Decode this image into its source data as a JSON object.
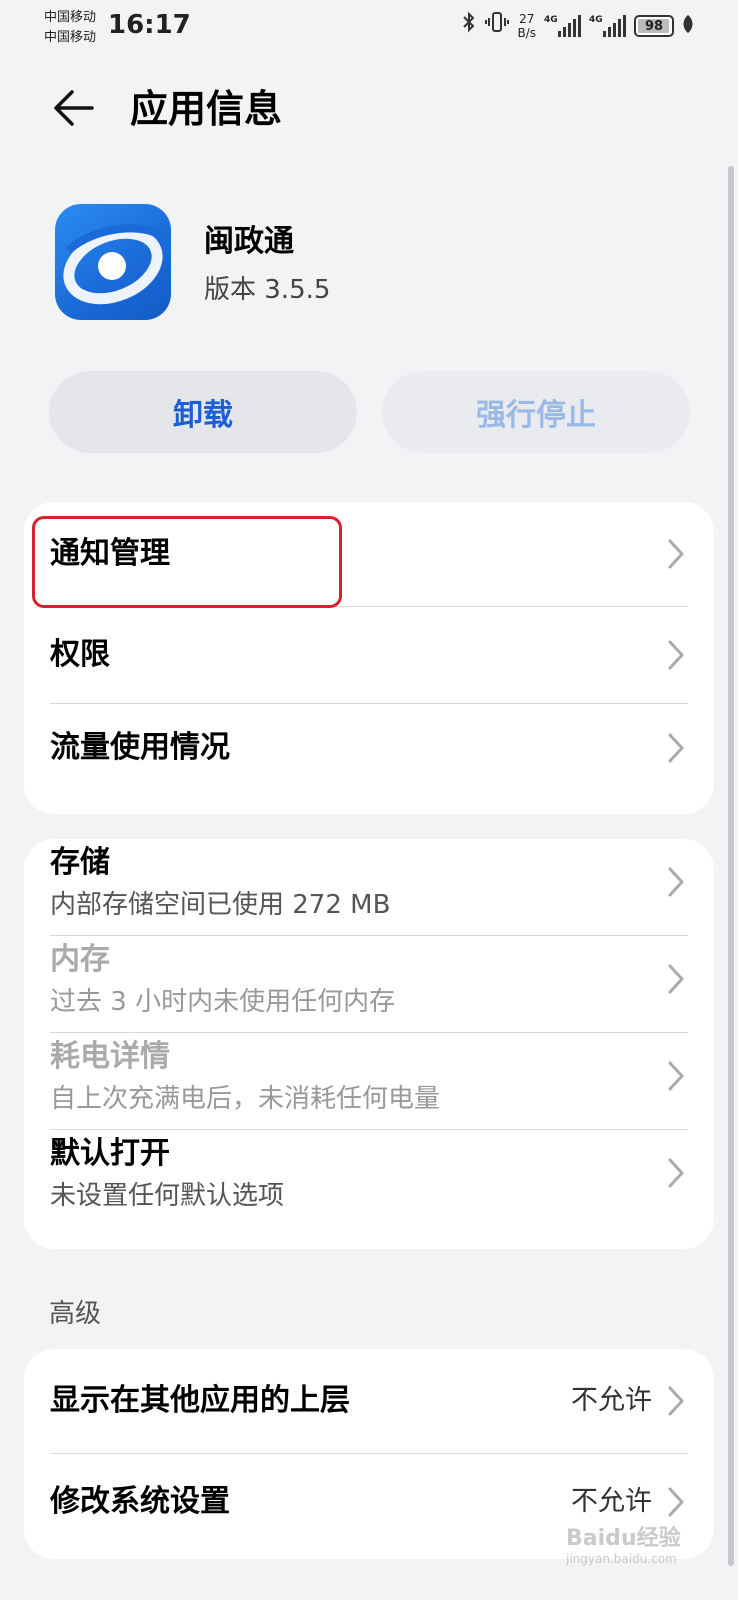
{
  "status_bar": {
    "carrier_1": "中国移动",
    "carrier_2": "中国移动",
    "time": "16:17",
    "net_speed_value": "27",
    "net_speed_unit": "B/s",
    "signal_1_type": "4G",
    "signal_2_type": "4G",
    "battery": "98"
  },
  "header": {
    "title": "应用信息"
  },
  "app": {
    "name": "闽政通",
    "version": "版本 3.5.5"
  },
  "actions": {
    "uninstall": "卸载",
    "force_stop": "强行停止"
  },
  "group_1": {
    "items": [
      {
        "label": "通知管理"
      },
      {
        "label": "权限"
      },
      {
        "label": "流量使用情况"
      }
    ]
  },
  "group_2": {
    "items": [
      {
        "label": "存储",
        "sub": "内部存储空间已使用 272 MB"
      },
      {
        "label": "内存",
        "sub": "过去 3 小时内未使用任何内存"
      },
      {
        "label": "耗电详情",
        "sub": "自上次充满电后，未消耗任何电量"
      },
      {
        "label": "默认打开",
        "sub": "未设置任何默认选项"
      }
    ]
  },
  "advanced": {
    "header": "高级",
    "items": [
      {
        "label": "显示在其他应用的上层",
        "value": "不允许"
      },
      {
        "label": "修改系统设置",
        "value": "不允许"
      }
    ]
  },
  "watermark": {
    "brand": "Baidu经验",
    "url": "jingyan.baidu.com"
  },
  "colors": {
    "accent": "#1b5fd6",
    "highlight": "#d9212c",
    "background": "#f1f3f5"
  },
  "icons": [
    "back-arrow-icon",
    "bluetooth-icon",
    "vibrate-icon",
    "signal-icon",
    "battery-icon",
    "leaf-icon",
    "chevron-right-icon"
  ]
}
